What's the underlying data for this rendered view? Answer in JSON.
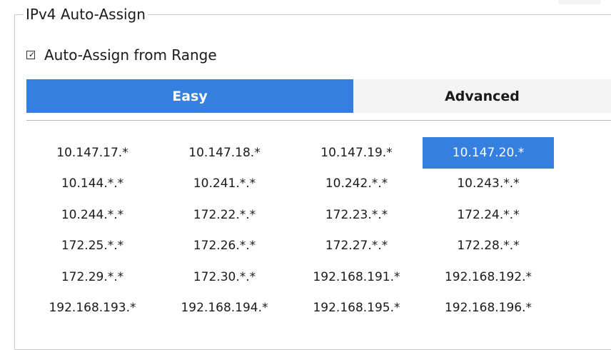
{
  "group": {
    "title": "IPv4 Auto-Assign"
  },
  "auto_assign": {
    "label": "Auto-Assign from Range",
    "checked": true
  },
  "tabs": [
    {
      "label": "Easy",
      "active": true
    },
    {
      "label": "Advanced",
      "active": false
    }
  ],
  "ranges": [
    "10.147.17.*",
    "10.147.18.*",
    "10.147.19.*",
    "10.147.20.*",
    "10.144.*.*",
    "10.241.*.*",
    "10.242.*.*",
    "10.243.*.*",
    "10.244.*.*",
    "172.22.*.*",
    "172.23.*.*",
    "172.24.*.*",
    "172.25.*.*",
    "172.26.*.*",
    "172.27.*.*",
    "172.28.*.*",
    "172.29.*.*",
    "172.30.*.*",
    "192.168.191.*",
    "192.168.192.*",
    "192.168.193.*",
    "192.168.194.*",
    "192.168.195.*",
    "192.168.196.*"
  ],
  "selected_range": "10.147.20.*",
  "colors": {
    "accent": "#3580de",
    "tab_inactive_bg": "#f4f4f4",
    "border": "#c8c8c8"
  }
}
